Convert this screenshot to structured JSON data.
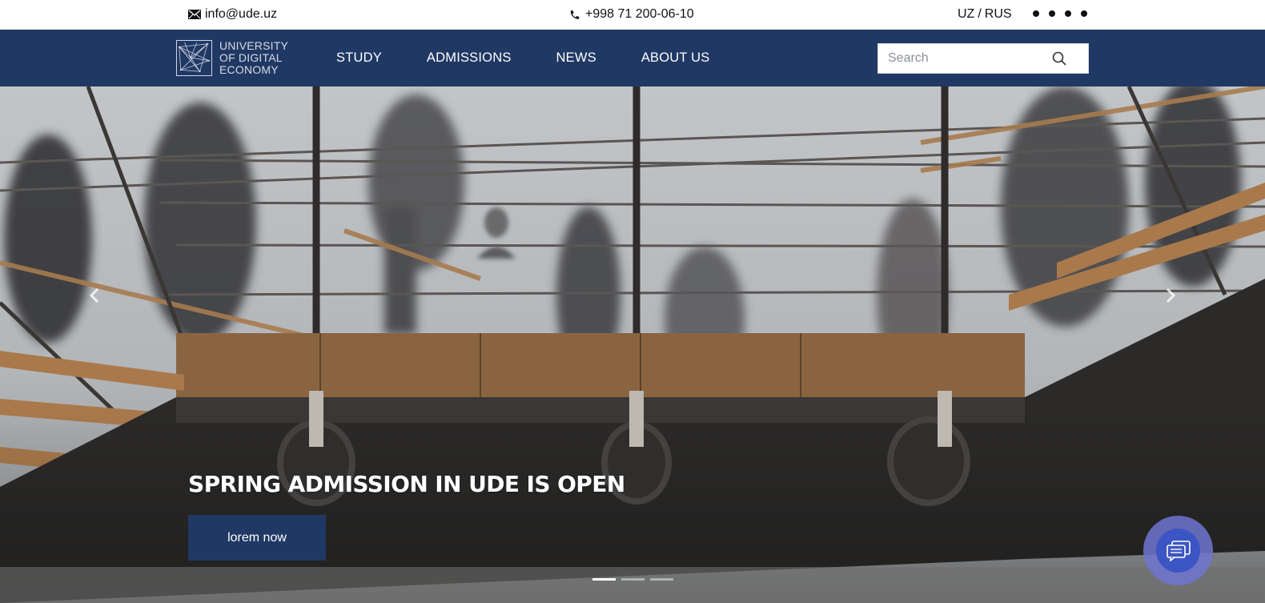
{
  "topbar": {
    "email": "info@ude.uz",
    "phone": "+998 71 200-06-10",
    "lang_uz": "UZ",
    "lang_separator": "/",
    "lang_ru": "RUS",
    "social_icons": [
      "social-icon-1",
      "social-icon-2",
      "social-icon-3",
      "social-icon-4"
    ]
  },
  "navbar": {
    "logo": {
      "line1": "UNIVERSITY",
      "line2": "OF DIGITAL",
      "line3": "ECONOMY"
    },
    "links": [
      {
        "label": "STUDY"
      },
      {
        "label": "ADMISSIONS"
      },
      {
        "label": "NEWS"
      },
      {
        "label": "ABOUT US"
      }
    ],
    "search": {
      "placeholder": "Search",
      "value": ""
    }
  },
  "hero": {
    "title": "SPRING ADMISSION IN UDE IS OPEN",
    "cta_label": "lorem now",
    "slide_count": 3,
    "active_slide": 1
  },
  "colors": {
    "brand_navy": "#203864",
    "chat_outer": "#6e76d0",
    "chat_inner": "#3c55c4",
    "white": "#ffffff"
  },
  "icons": {
    "email": "envelope-icon",
    "phone": "phone-icon",
    "search": "search-icon",
    "prev": "chevron-left-icon",
    "next": "chevron-right-icon",
    "chat": "chat-icon"
  }
}
